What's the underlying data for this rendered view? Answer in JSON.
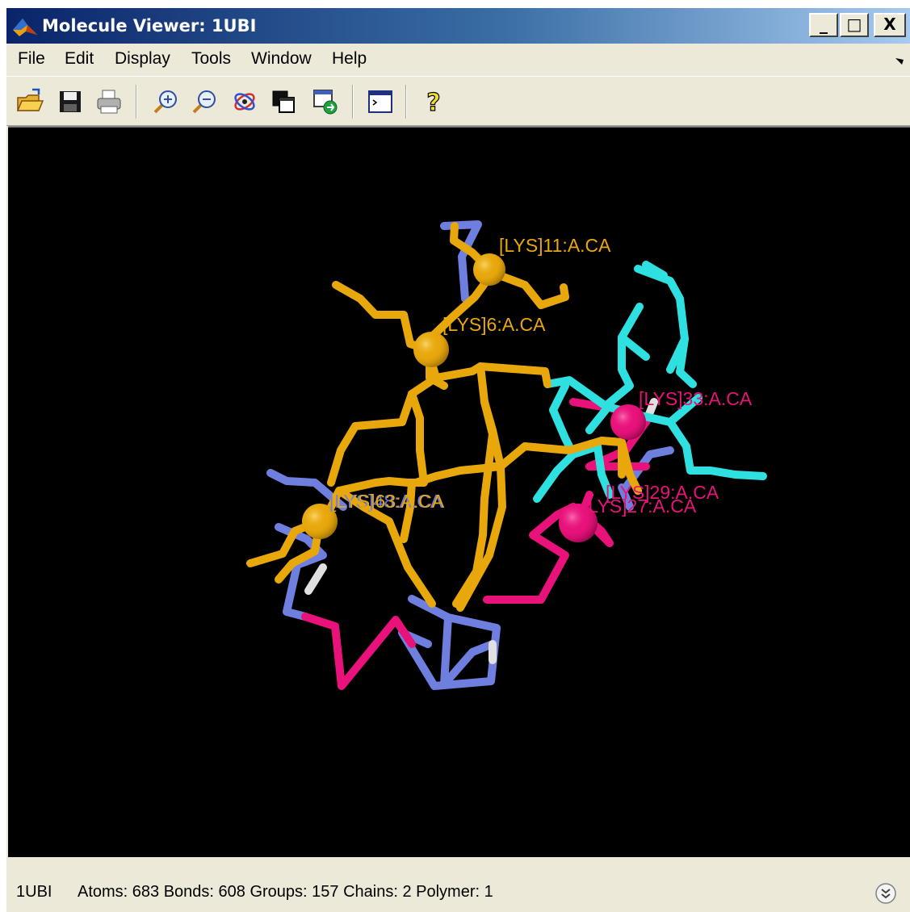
{
  "window": {
    "title": "Molecule Viewer: 1UBI"
  },
  "window_controls": {
    "minimize": "_",
    "maximize": "□",
    "close": "X"
  },
  "menu": {
    "file": "File",
    "edit": "Edit",
    "display": "Display",
    "tools": "Tools",
    "window": "Window",
    "help": "Help"
  },
  "toolbar": {
    "icons": [
      "open-folder-icon",
      "save-icon",
      "print-icon",
      "zoom-in-icon",
      "zoom-out-icon",
      "rotate-molecule-icon",
      "copy-window-icon",
      "export-icon",
      "command-window-icon",
      "help-icon"
    ],
    "help_glyph": "?"
  },
  "viewer": {
    "labels": {
      "lys11": "[LYS]11:A.CA",
      "lys6": "[LYS]6:A.CA",
      "lys33": "[LYS]33:A.CA",
      "lys29": "[LYS]29:A.CA",
      "lys27": "[LYS]27:A.CA",
      "lys48": "[LYS]48:A.CA",
      "lys63": "[LYS]63:A.CA"
    },
    "colors": {
      "background": "#000000",
      "yellow": "#e8a80c",
      "magenta": "#e8127a",
      "blue": "#6f7fe0",
      "cyan": "#2ee0e0",
      "white": "#e0e0e0"
    }
  },
  "status": {
    "name": "1UBI",
    "stats": "Atoms: 683  Bonds: 608  Groups: 157  Chains: 2  Polymer: 1"
  }
}
